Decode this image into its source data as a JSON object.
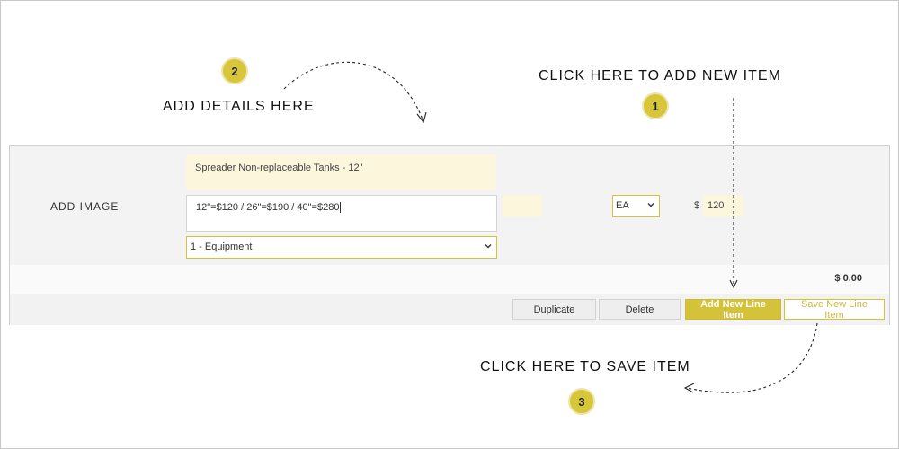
{
  "annotations": {
    "step1": {
      "number": "1",
      "text": "CLICK HERE TO ADD NEW ITEM"
    },
    "step2": {
      "number": "2",
      "text": "ADD DETAILS HERE"
    },
    "step3": {
      "number": "3",
      "text": "CLICK HERE TO SAVE ITEM"
    }
  },
  "line_item": {
    "add_image_label": "ADD IMAGE",
    "description": "Spreader Non-replaceable Tanks - 12\"",
    "notes": "12\"=$120 / 26\"=$190 / 40\"=$280",
    "category": "1 - Equipment",
    "quantity": "",
    "unit": "EA",
    "currency_symbol": "$",
    "price": "120",
    "total": "$ 0.00"
  },
  "actions": {
    "duplicate_label": "Duplicate",
    "delete_label": "Delete",
    "add_label": "Add New Line Item",
    "save_label": "Save New Line Item"
  },
  "colors": {
    "accent": "#d4c23a",
    "badge": "#d7c63a",
    "field_highlight": "#fbf6dc"
  },
  "icons": {
    "category_select": "chevron-down-icon",
    "unit_select": "chevron-down-icon"
  }
}
